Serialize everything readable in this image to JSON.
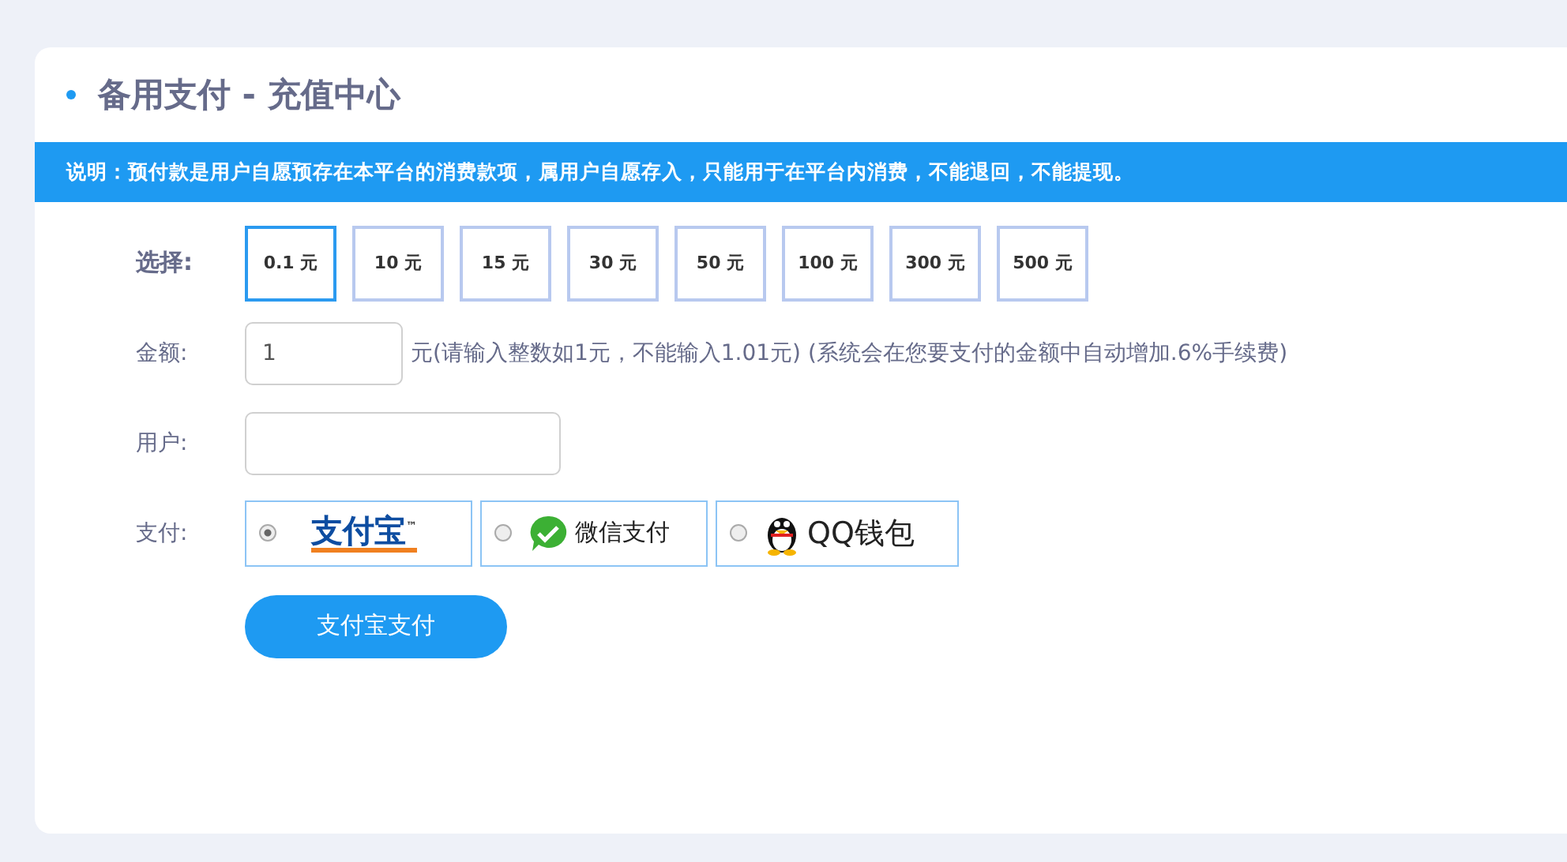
{
  "title": "备用支付 - 充值中心",
  "notice": "说明：预付款是用户自愿预存在本平台的消费款项，属用户自愿存入，只能用于在平台内消费，不能退回，不能提现。",
  "amount_choice": {
    "label": "选择:",
    "options": [
      {
        "text": "0.1 元",
        "selected": true
      },
      {
        "text": "10 元",
        "selected": false
      },
      {
        "text": "15 元",
        "selected": false
      },
      {
        "text": "30 元",
        "selected": false
      },
      {
        "text": "50 元",
        "selected": false
      },
      {
        "text": "100 元",
        "selected": false
      },
      {
        "text": "300 元",
        "selected": false
      },
      {
        "text": "500 元",
        "selected": false
      }
    ]
  },
  "amount": {
    "label": "金额:",
    "value": "1",
    "hint": "元(请输入整数如1元，不能输入1.01元) (系统会在您要支付的金额中自动增加.6%手续费)"
  },
  "user": {
    "label": "用户:"
  },
  "payment": {
    "label": "支付:",
    "methods": [
      {
        "kind": "alipay",
        "text": "支付宝",
        "mark": "™",
        "selected": true
      },
      {
        "kind": "wechat",
        "text": "微信支付",
        "selected": false
      },
      {
        "kind": "qq",
        "text": "QQ钱包",
        "selected": false
      }
    ]
  },
  "submit": "支付宝支付"
}
